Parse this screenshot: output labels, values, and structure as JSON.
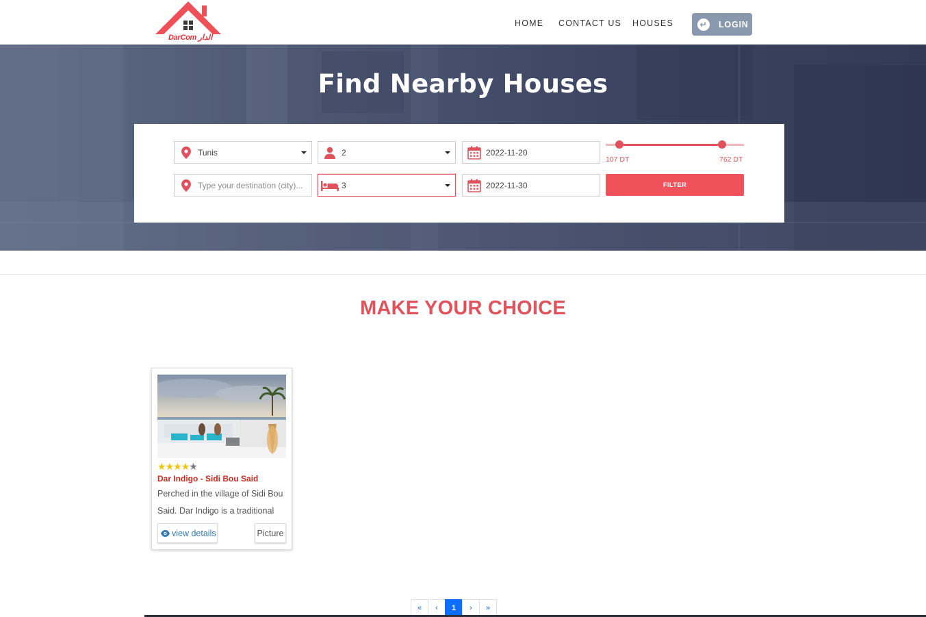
{
  "nav": {
    "logo_text": "DarCom الدار",
    "links": {
      "home": "HOME",
      "contact": "CONTACT US",
      "houses": "HOUSES"
    },
    "login_label": "LOGIN"
  },
  "hero": {
    "title": "Find Nearby Houses"
  },
  "search": {
    "city_value": "Tunis",
    "destination_placeholder": "Type your destination (city)...",
    "guests_value": "2",
    "beds_value": "3",
    "checkin_value": "2022-11-20",
    "checkout_value": "2022-11-30",
    "price_min_label": "107 DT",
    "price_max_label": "762 DT",
    "price_min_fraction": 0.1,
    "price_max_fraction": 0.84,
    "filter_label": "FILTER"
  },
  "section": {
    "title": "MAKE YOUR CHOICE"
  },
  "listings": [
    {
      "rating": 4,
      "max_rating": 5,
      "title": "Dar Indigo - Sidi Bou Said",
      "description": "Perched in the village of Sidi Bou Said. Dar Indigo is a traditional",
      "details_label": "view details",
      "picture_label": "Picture"
    }
  ],
  "pagination": {
    "first": "«",
    "prev": "‹",
    "current": "1",
    "next": "›",
    "last": "»"
  },
  "colors": {
    "accent": "#e0535c",
    "login_bg": "#8a98ad",
    "hero_bg": "#4c5671",
    "link_blue": "#337ab7",
    "pagination_active": "#0d6efd"
  },
  "icons": {
    "login": "login-arrow-icon",
    "location": "map-pin-icon",
    "guests": "user-icon",
    "beds": "bed-icon",
    "calendar": "calendar-icon",
    "details": "eye-icon"
  }
}
